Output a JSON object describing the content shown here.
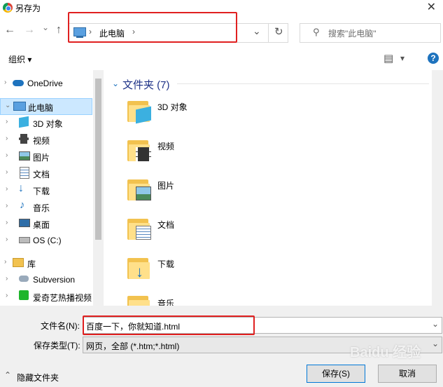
{
  "window": {
    "title": "另存为",
    "close": "✕"
  },
  "nav": {
    "back": "←",
    "forward": "→",
    "dropdown": "⌄",
    "up": "↑",
    "breadcrumb_sep": "›",
    "location": "此电脑",
    "breadcrumb_end": "›",
    "address_dropdown": "⌄",
    "refresh": "↻",
    "search_placeholder": "搜索\"此电脑\"",
    "search_icon": "⚲"
  },
  "toolbar": {
    "organize": "组织 ▾",
    "view_icon": "▤",
    "view_dropdown": "▾",
    "help": "?"
  },
  "sidebar": {
    "items": [
      {
        "label": "OneDrive",
        "icon": "cloud-icon"
      },
      {
        "label": "此电脑",
        "icon": "computer-icon"
      },
      {
        "label": "3D 对象",
        "icon": "cube-icon"
      },
      {
        "label": "视频",
        "icon": "video-icon"
      },
      {
        "label": "图片",
        "icon": "picture-icon"
      },
      {
        "label": "文档",
        "icon": "document-icon"
      },
      {
        "label": "下载",
        "icon": "download-icon"
      },
      {
        "label": "音乐",
        "icon": "music-icon"
      },
      {
        "label": "桌面",
        "icon": "desktop-icon"
      },
      {
        "label": "OS (C:)",
        "icon": "drive-icon"
      },
      {
        "label": "库",
        "icon": "library-icon"
      },
      {
        "label": "Subversion",
        "icon": "subversion-icon"
      },
      {
        "label": "爱奇艺热播视频",
        "icon": "iqiyi-icon"
      }
    ]
  },
  "main": {
    "group_header": "文件夹 (7)",
    "folders": [
      {
        "label": "3D 对象"
      },
      {
        "label": "视频"
      },
      {
        "label": "图片"
      },
      {
        "label": "文档"
      },
      {
        "label": "下载"
      },
      {
        "label": "音乐"
      }
    ]
  },
  "bottom": {
    "filename_label": "文件名(N):",
    "filename_value": "百度一下，你就知道.html",
    "filetype_label": "保存类型(T):",
    "filetype_value": "网页，全部 (*.htm;*.html)",
    "hide_folders": "隐藏文件夹",
    "save": "保存(S)",
    "cancel": "取消"
  },
  "watermark": {
    "text": "Baidu 经验"
  },
  "colors": {
    "highlight_red": "#e02020",
    "selected_bg": "#cce8ff",
    "folder_yellow": "#f2c24f",
    "accent_blue": "#1e73be"
  }
}
